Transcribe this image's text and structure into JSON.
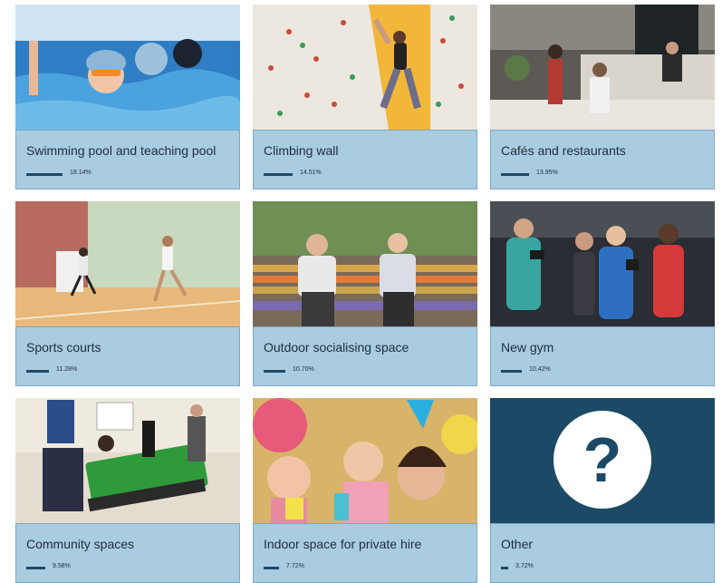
{
  "options": [
    {
      "label": "Swimming pool and teaching pool",
      "percent": "18.14%",
      "share": 18.14,
      "image": "swimming-pool-photo"
    },
    {
      "label": "Climbing wall",
      "percent": "14.51%",
      "share": 14.51,
      "image": "climbing-wall-photo"
    },
    {
      "label": "Cafés and restaurants",
      "percent": "13.95%",
      "share": 13.95,
      "image": "cafe-photo"
    },
    {
      "label": "Sports courts",
      "percent": "11.28%",
      "share": 11.28,
      "image": "sports-court-photo"
    },
    {
      "label": "Outdoor socialising space",
      "percent": "10.70%",
      "share": 10.7,
      "image": "outdoor-space-photo"
    },
    {
      "label": "New gym",
      "percent": "10.42%",
      "share": 10.42,
      "image": "gym-photo"
    },
    {
      "label": "Community spaces",
      "percent": "9.58%",
      "share": 9.58,
      "image": "community-space-photo"
    },
    {
      "label": "Indoor space for private hire",
      "percent": "7.72%",
      "share": 7.72,
      "image": "party-photo"
    },
    {
      "label": "Other",
      "percent": "3.72%",
      "share": 3.72,
      "image": "question-mark-icon"
    }
  ],
  "colors": {
    "panel": "#a9cce1",
    "bar": "#1e4a66",
    "other_bg": "#1c4a66"
  }
}
